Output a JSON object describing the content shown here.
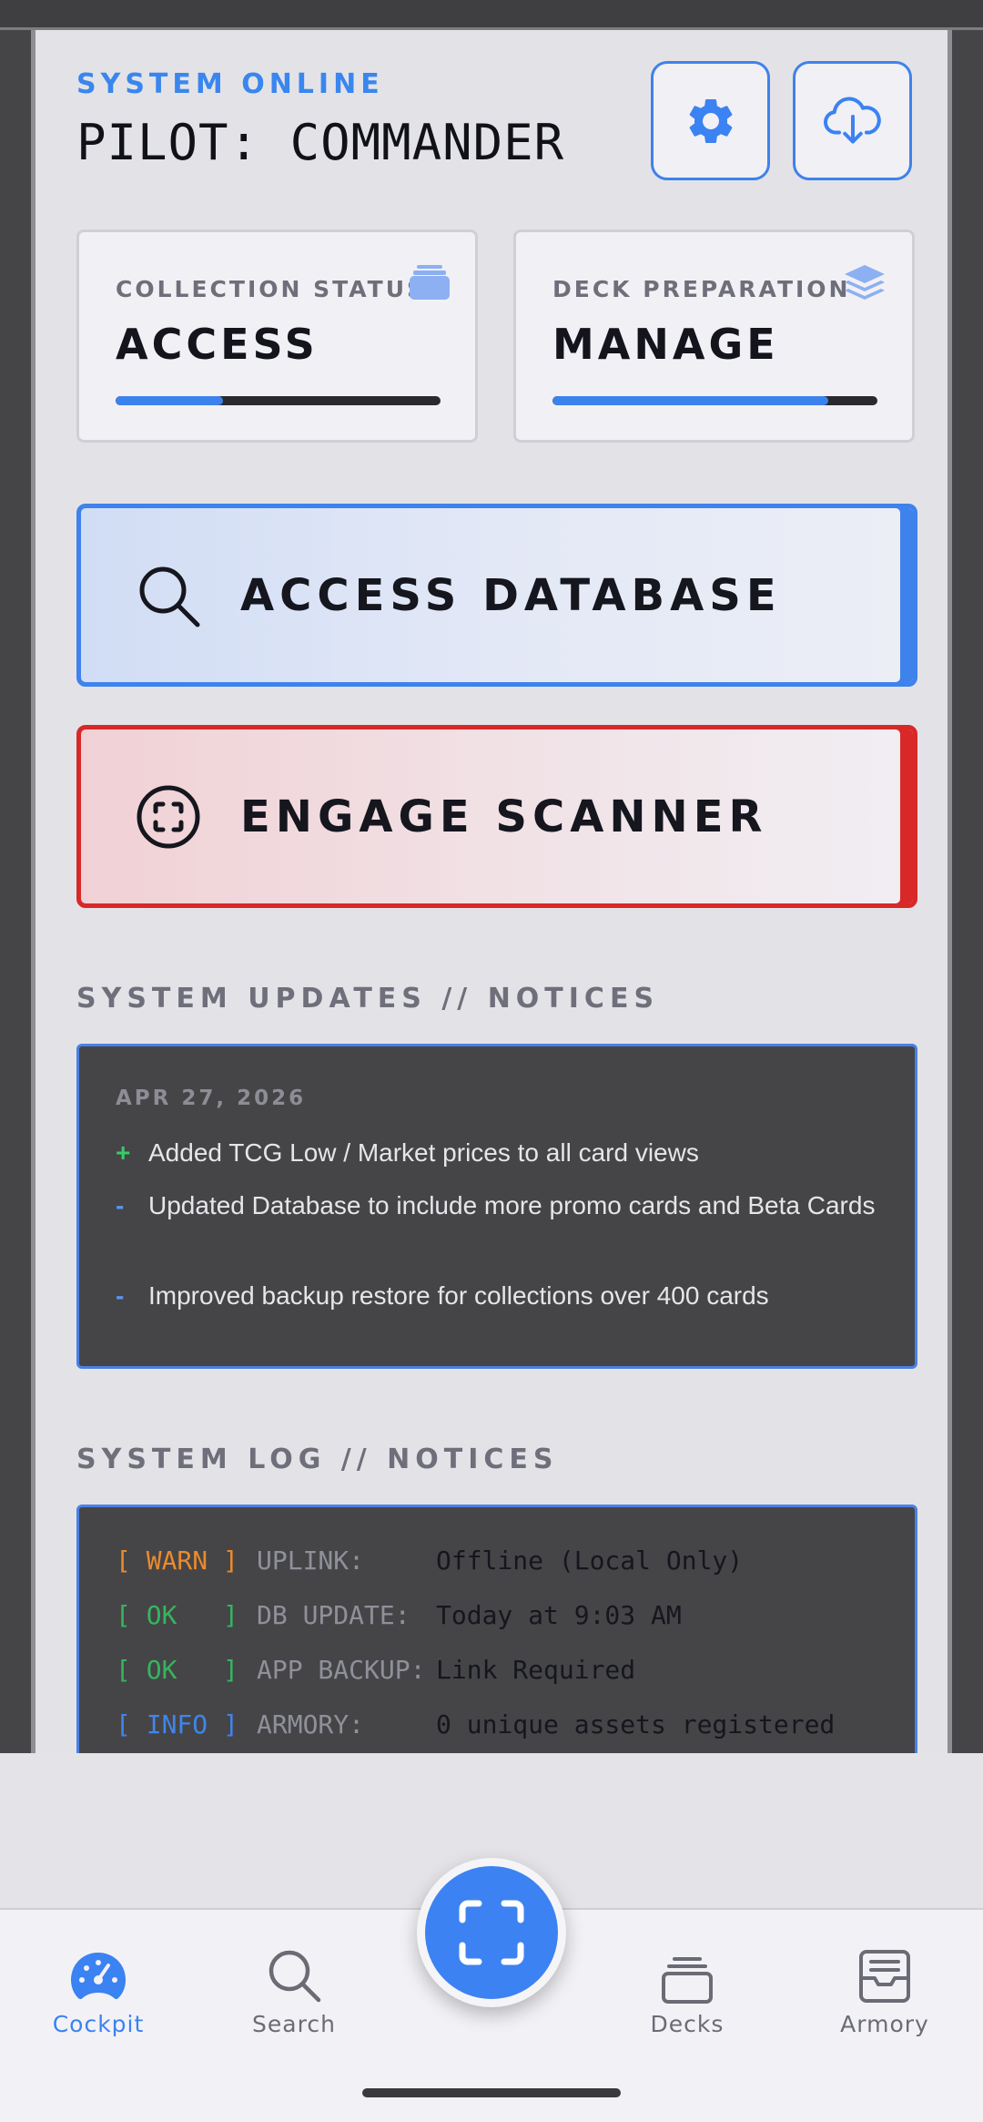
{
  "header": {
    "status": "SYSTEM ONLINE",
    "pilot": "PILOT: COMMANDER",
    "settings_icon": "gear-icon",
    "backup_icon": "cloud-download-icon"
  },
  "stats": [
    {
      "label": "COLLECTION STATUS",
      "value": "ACCESS",
      "icon": "cards-icon",
      "progress": 0.33
    },
    {
      "label": "DECK PREPARATION",
      "value": "MANAGE",
      "icon": "layers-icon",
      "progress": 0.85
    }
  ],
  "actions": {
    "database": {
      "label": "ACCESS DATABASE",
      "icon": "search-icon",
      "accent": "#3e82ec"
    },
    "scanner": {
      "label": "ENGAGE SCANNER",
      "icon": "scan-icon",
      "accent": "#d82828"
    }
  },
  "updates": {
    "title": "SYSTEM UPDATES // NOTICES",
    "date": "APR 27, 2026",
    "items": [
      {
        "mark": "+",
        "text": "Added TCG Low / Market prices to all card views"
      },
      {
        "mark": "-",
        "text": "Updated Database to include more promo cards and Beta Cards"
      },
      {
        "mark": "-",
        "text": "Improved backup restore for collections over 400 cards"
      }
    ]
  },
  "log": {
    "title": "SYSTEM LOG // NOTICES",
    "rows": [
      {
        "tag": "[ WARN ]",
        "key": "UPLINK:",
        "value": "Offline (Local Only)"
      },
      {
        "tag": "[ OK   ]",
        "key": "DB UPDATE:",
        "value": "Today at 9:03 AM"
      },
      {
        "tag": "[ OK   ]",
        "key": "APP BACKUP:",
        "value": "Link Required"
      },
      {
        "tag": "[ INFO ]",
        "key": "ARMORY:",
        "value": "0 unique assets registered"
      }
    ]
  },
  "tabs": [
    {
      "label": "Cockpit",
      "icon": "dashboard-icon",
      "active": true
    },
    {
      "label": "Search",
      "icon": "search-icon",
      "active": false
    },
    {
      "label": "Decks",
      "icon": "decks-icon",
      "active": false
    },
    {
      "label": "Armory",
      "icon": "archive-icon",
      "active": false
    }
  ],
  "fab": {
    "icon": "scan-icon"
  },
  "colors": {
    "accent": "#3b82f2",
    "danger": "#d82828",
    "success": "#35b55e",
    "warning": "#ea8a2e"
  }
}
